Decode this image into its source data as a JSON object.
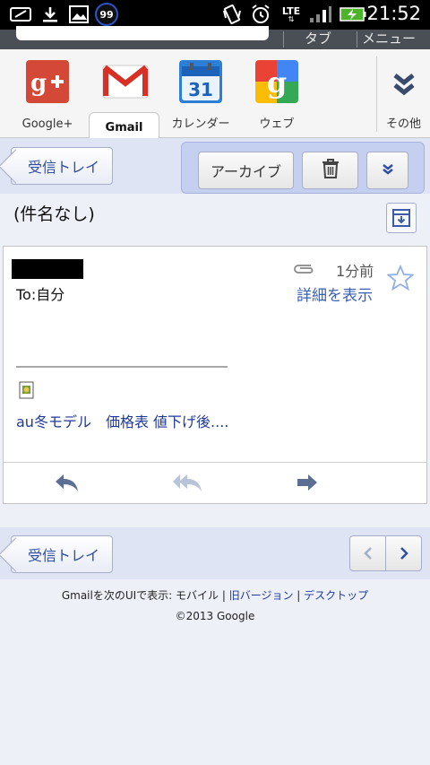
{
  "status_bar": {
    "badge_count": "99",
    "network": "LTE",
    "time": "21:52"
  },
  "browser": {
    "tab_label": "タブ",
    "menu_label": "メニュー"
  },
  "app_tabs": [
    {
      "label": "Google+",
      "icon": "google-plus-icon"
    },
    {
      "label": "Gmail",
      "icon": "gmail-icon",
      "active": true
    },
    {
      "label": "カレンダー",
      "icon": "calendar-icon",
      "calendar_day": "31"
    },
    {
      "label": "ウェブ",
      "icon": "google-web-icon"
    },
    {
      "label": "その他",
      "icon": "chevron-double-down-icon"
    }
  ],
  "toolbar": {
    "back_label": "受信トレイ",
    "archive_label": "アーカイブ"
  },
  "message": {
    "subject": "(件名なし)",
    "to": "To:自分",
    "time_ago": "1分前",
    "details_link": "詳細を表示",
    "attachment_name": "au冬モデル　価格表 値下げ後...."
  },
  "bottom_nav": {
    "back_label": "受信トレイ"
  },
  "footer": {
    "prefix": "Gmailを次のUIで表示: モバイル | ",
    "link_old": "旧バージョン",
    "separator": " | ",
    "link_desktop": "デスクトップ",
    "copyright": "©2013 Google"
  },
  "colors": {
    "link": "#3a5fb0",
    "toolbar_bg": "#dfe4f5",
    "panel_bg": "#c5cff0"
  }
}
